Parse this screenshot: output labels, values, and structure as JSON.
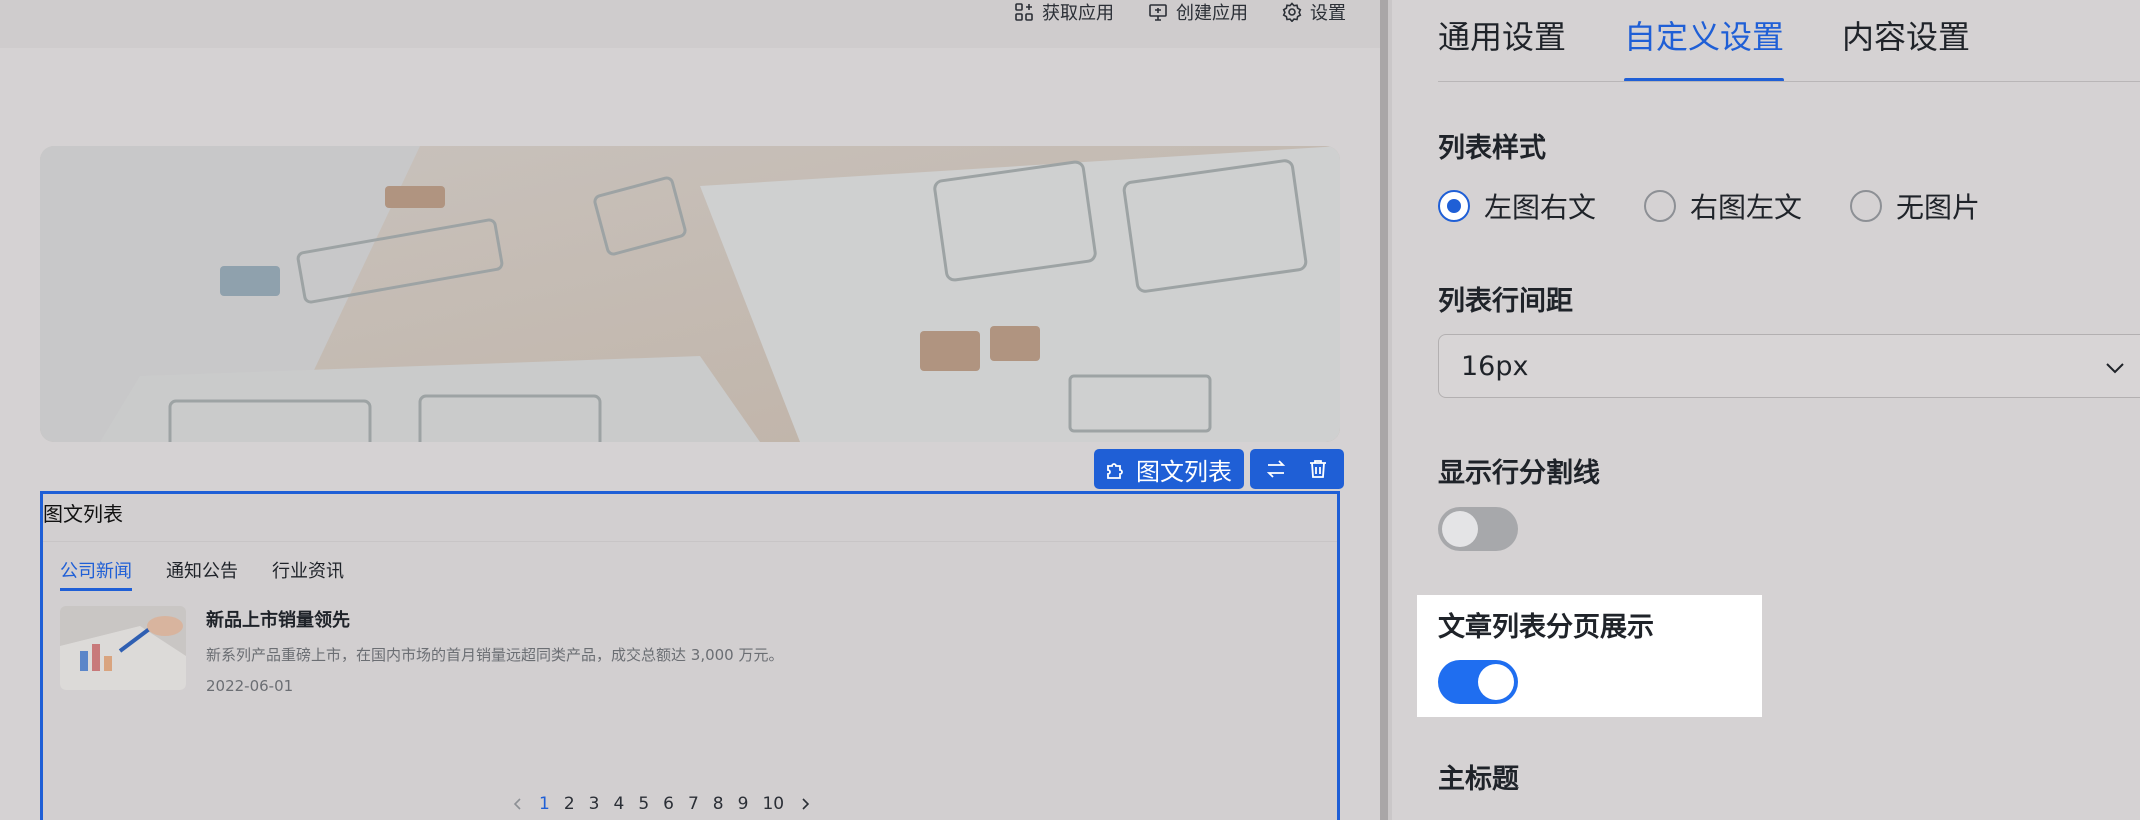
{
  "topbar": {
    "get_app": "获取应用",
    "create_app": "创建应用",
    "settings": "设置"
  },
  "floating_tools": {
    "component_label": "图文列表"
  },
  "widget": {
    "title": "图文列表",
    "tabs": [
      "公司新闻",
      "通知公告",
      "行业资讯"
    ],
    "article": {
      "title": "新品上市销量领先",
      "desc": "新系列产品重磅上市，在国内市场的首月销量远超同类产品，成交总额达 3,000 万元。",
      "date": "2022-06-01"
    },
    "pager": [
      "1",
      "2",
      "3",
      "4",
      "5",
      "6",
      "7",
      "8",
      "9",
      "10"
    ],
    "current_page": "1"
  },
  "panel": {
    "tabs": [
      "通用设置",
      "自定义设置",
      "内容设置"
    ],
    "active_tab": "自定义设置",
    "list_style_label": "列表样式",
    "list_style_options": [
      "左图右文",
      "右图左文",
      "无图片"
    ],
    "list_style_selected": "左图右文",
    "row_spacing_label": "列表行间距",
    "row_spacing_value": "16px",
    "divider_label": "显示行分割线",
    "divider_on": false,
    "pagination_label": "文章列表分页展示",
    "pagination_on": true,
    "main_title_label": "主标题"
  },
  "colors": {
    "accent": "#1f5fd6",
    "toggle_on": "#1f6ef0"
  }
}
